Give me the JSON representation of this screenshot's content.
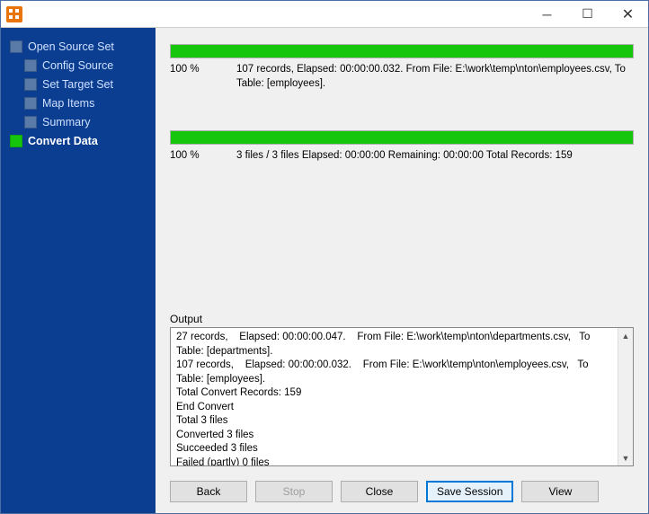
{
  "sidebar": {
    "items": [
      {
        "label": "Open Source Set"
      },
      {
        "label": "Config Source"
      },
      {
        "label": "Set Target Set"
      },
      {
        "label": "Map Items"
      },
      {
        "label": "Summary"
      },
      {
        "label": "Convert Data"
      }
    ]
  },
  "progress1": {
    "percent": "100 %",
    "details": "107 records,    Elapsed: 00:00:00.032.    From File: E:\\work\\temp\\nton\\employees.csv,   To Table: [employees]."
  },
  "progress2": {
    "percent": "100 %",
    "details": "3 files / 3 files    Elapsed: 00:00:00    Remaining: 00:00:00    Total Records: 159"
  },
  "output": {
    "label": "Output",
    "text": "27 records,    Elapsed: 00:00:00.047.    From File: E:\\work\\temp\\nton\\departments.csv,   To Table: [departments].\n107 records,    Elapsed: 00:00:00.032.    From File: E:\\work\\temp\\nton\\employees.csv,   To Table: [employees].\nTotal Convert Records: 159\nEnd Convert\nTotal 3 files\nConverted 3 files\nSucceeded 3 files\nFailed (partly) 0 files"
  },
  "buttons": {
    "back": "Back",
    "stop": "Stop",
    "close": "Close",
    "save_session": "Save Session",
    "view": "View"
  }
}
